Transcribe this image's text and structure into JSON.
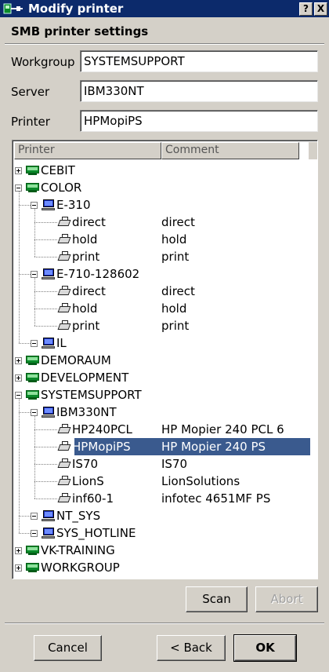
{
  "window": {
    "title": "Modify printer",
    "help_label": "?",
    "close_label": "X"
  },
  "section": {
    "title": "SMB printer settings"
  },
  "fields": {
    "workgroup": {
      "label": "Workgroup",
      "value": "SYSTEMSUPPORT"
    },
    "server": {
      "label": "Server",
      "value": "IBM330NT"
    },
    "printer": {
      "label": "Printer",
      "value": "HPMopiPS"
    }
  },
  "tree": {
    "columns": [
      "Printer",
      "Comment"
    ],
    "rows": [
      {
        "label": "CEBIT",
        "comment": "",
        "depth": 0,
        "icon": "network-icon",
        "expander": "plus"
      },
      {
        "label": "COLOR",
        "comment": "",
        "depth": 0,
        "icon": "network-icon",
        "expander": "minus"
      },
      {
        "label": "E-310",
        "comment": "",
        "depth": 1,
        "icon": "computer-icon",
        "expander": "minus"
      },
      {
        "label": "direct",
        "comment": "direct",
        "depth": 2,
        "icon": "printer-icon",
        "expander": ""
      },
      {
        "label": "hold",
        "comment": "hold",
        "depth": 2,
        "icon": "printer-icon",
        "expander": ""
      },
      {
        "label": "print",
        "comment": "print",
        "depth": 2,
        "icon": "printer-icon",
        "expander": ""
      },
      {
        "label": "E-710-128602",
        "comment": "",
        "depth": 1,
        "icon": "computer-icon",
        "expander": "minus"
      },
      {
        "label": "direct",
        "comment": "direct",
        "depth": 2,
        "icon": "printer-icon",
        "expander": ""
      },
      {
        "label": "hold",
        "comment": "hold",
        "depth": 2,
        "icon": "printer-icon",
        "expander": ""
      },
      {
        "label": "print",
        "comment": "print",
        "depth": 2,
        "icon": "printer-icon",
        "expander": ""
      },
      {
        "label": "IL",
        "comment": "",
        "depth": 1,
        "icon": "computer-icon",
        "expander": "minus"
      },
      {
        "label": "DEMORAUM",
        "comment": "",
        "depth": 0,
        "icon": "network-icon",
        "expander": "plus"
      },
      {
        "label": "DEVELOPMENT",
        "comment": "",
        "depth": 0,
        "icon": "network-icon",
        "expander": "plus"
      },
      {
        "label": "SYSTEMSUPPORT",
        "comment": "",
        "depth": 0,
        "icon": "network-icon",
        "expander": "minus"
      },
      {
        "label": "IBM330NT",
        "comment": "",
        "depth": 1,
        "icon": "computer-icon",
        "expander": "minus"
      },
      {
        "label": "HP240PCL",
        "comment": "HP Mopier 240 PCL 6",
        "depth": 2,
        "icon": "printer-icon",
        "expander": ""
      },
      {
        "label": "HPMopiPS",
        "comment": "HP Mopier 240 PS",
        "depth": 2,
        "icon": "printer-icon",
        "expander": "",
        "selected": true
      },
      {
        "label": "IS70",
        "comment": "IS70",
        "depth": 2,
        "icon": "printer-icon",
        "expander": ""
      },
      {
        "label": "LionS",
        "comment": "LionSolutions",
        "depth": 2,
        "icon": "printer-icon",
        "expander": ""
      },
      {
        "label": "inf60-1",
        "comment": "infotec 4651MF PS",
        "depth": 2,
        "icon": "printer-icon",
        "expander": ""
      },
      {
        "label": "NT_SYS",
        "comment": "",
        "depth": 1,
        "icon": "computer-icon",
        "expander": "minus"
      },
      {
        "label": "SYS_HOTLINE",
        "comment": "",
        "depth": 1,
        "icon": "computer-icon",
        "expander": "minus"
      },
      {
        "label": "VK-TRAINING",
        "comment": "",
        "depth": 0,
        "icon": "network-icon",
        "expander": "plus"
      },
      {
        "label": "WORKGROUP",
        "comment": "",
        "depth": 0,
        "icon": "network-icon",
        "expander": "plus"
      }
    ]
  },
  "buttons": {
    "scan": "Scan",
    "abort": "Abort",
    "cancel": "Cancel",
    "back": "< Back",
    "ok": "OK"
  },
  "colors": {
    "titlebar": "#0c2a6b",
    "selection": "#3a5a8e",
    "dialog": "#d4d0c8"
  }
}
